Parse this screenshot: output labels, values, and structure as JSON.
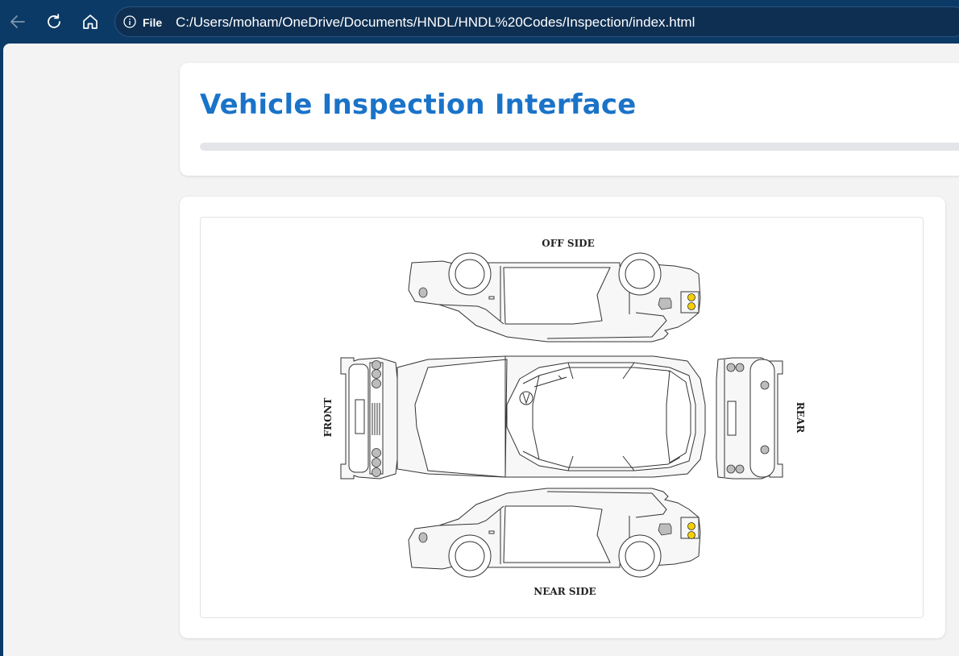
{
  "browser": {
    "file_label": "File",
    "url": "C:/Users/moham/OneDrive/Documents/HNDL/HNDL%20Codes/Inspection/index.html",
    "icons": [
      "back-arrow-icon",
      "refresh-icon",
      "home-icon",
      "info-icon"
    ]
  },
  "page": {
    "title": "Vehicle Inspection Interface",
    "progress_percent": 0
  },
  "diagram": {
    "labels": {
      "off_side": "OFF SIDE",
      "near_side": "NEAR SIDE",
      "front": "FRONT",
      "rear": "REAR"
    }
  },
  "colors": {
    "accent": "#1a73c8",
    "browser_bar": "#0b3a66",
    "light_yellow": "#f5d000"
  }
}
